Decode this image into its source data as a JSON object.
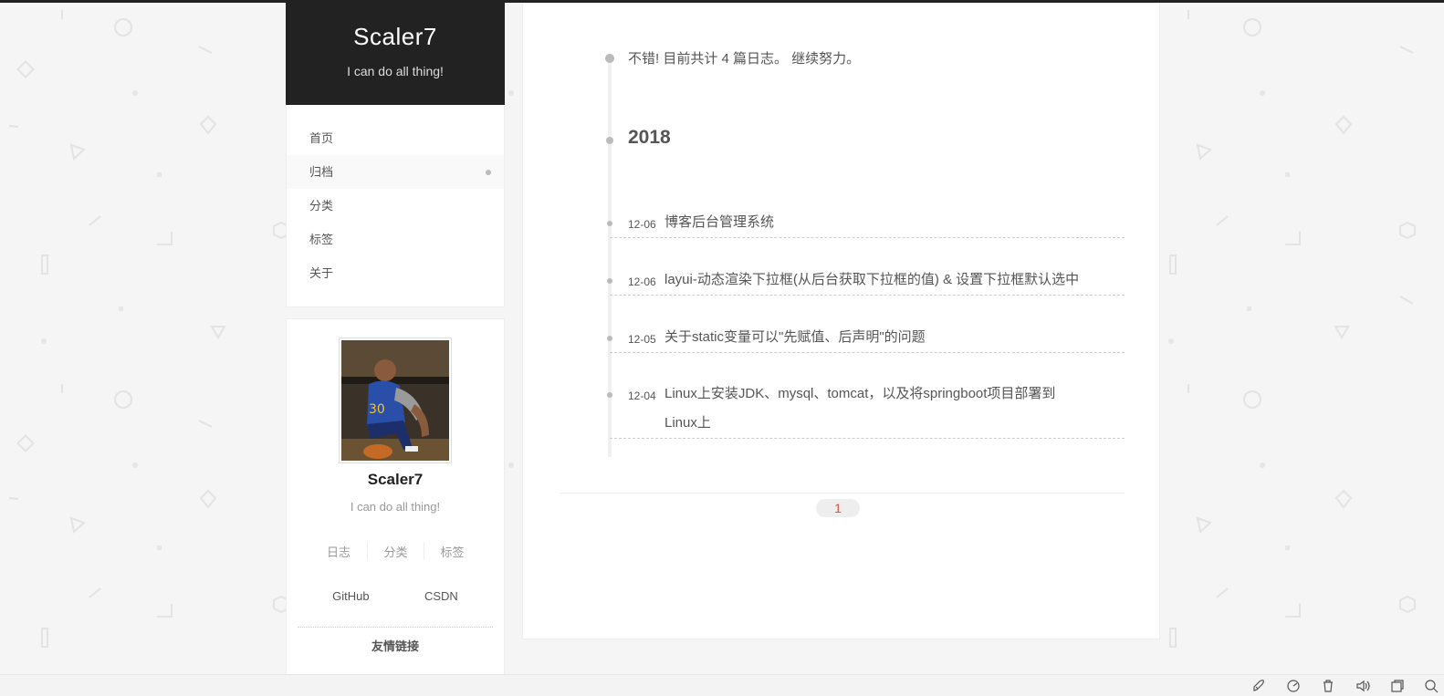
{
  "site": {
    "title": "Scaler7",
    "subtitle": "I can do all thing!"
  },
  "menu": {
    "items": [
      {
        "label": "首页"
      },
      {
        "label": "归档",
        "active": true
      },
      {
        "label": "分类"
      },
      {
        "label": "标签"
      },
      {
        "label": "关于"
      }
    ]
  },
  "profile": {
    "name": "Scaler7",
    "description": "I can do all thing!",
    "stats": [
      "日志",
      "分类",
      "标签"
    ],
    "links": [
      "GitHub",
      "CSDN"
    ],
    "friends_title": "友情链接"
  },
  "archive": {
    "summary": "不错! 目前共计 4 篇日志。 继续努力。",
    "year": "2018",
    "posts": [
      {
        "date": "12-06",
        "title": "博客后台管理系统"
      },
      {
        "date": "12-06",
        "title": "layui-动态渲染下拉框(从后台获取下拉框的值) & 设置下拉框默认选中"
      },
      {
        "date": "12-05",
        "title": "关于static变量可以\"先赋值、后声明\"的问题"
      },
      {
        "date": "12-04",
        "title_line1": "Linux上安装JDK、mysql、tomcat，以及将springboot项目部署到",
        "title_line2": "Linux上"
      }
    ],
    "page": "1"
  },
  "colors": {
    "header_bg": "#222222",
    "page_active": "#e74c3c"
  },
  "toolbar_icons": [
    "rocket-icon",
    "speed-icon",
    "trash-icon",
    "volume-icon",
    "window-icon",
    "search-icon"
  ]
}
